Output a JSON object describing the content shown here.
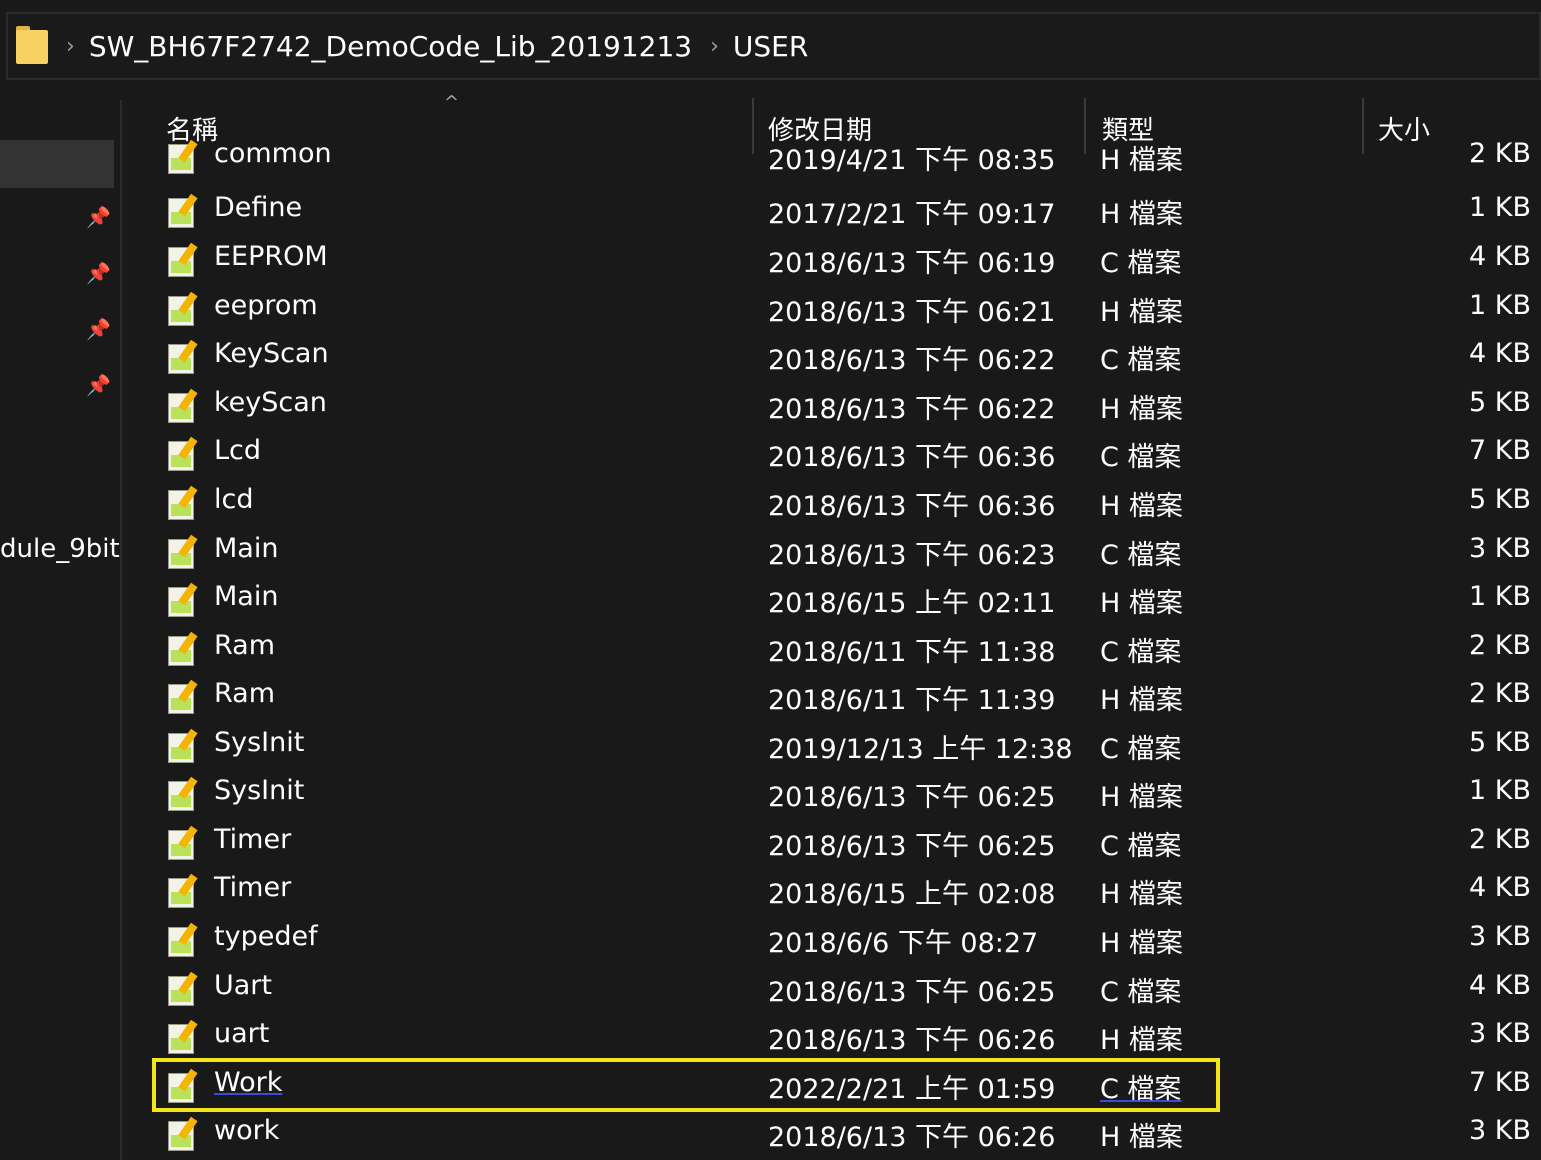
{
  "address_bar": {
    "crumbs": [
      "SW_BH67F2742_DemoCode_Lib_20191213",
      "USER"
    ],
    "separator": "›"
  },
  "nav_pane": {
    "partial_item": "dule_9bit"
  },
  "columns": {
    "name": "名稱",
    "date": "修改日期",
    "type": "類型",
    "size": "大小"
  },
  "files": [
    {
      "name": "common",
      "date": "2019/4/21 下午 08:35",
      "type": "H 檔案",
      "size": "2 KB"
    },
    {
      "name": "Define",
      "date": "2017/2/21 下午 09:17",
      "type": "H 檔案",
      "size": "1 KB"
    },
    {
      "name": "EEPROM",
      "date": "2018/6/13 下午 06:19",
      "type": "C 檔案",
      "size": "4 KB"
    },
    {
      "name": "eeprom",
      "date": "2018/6/13 下午 06:21",
      "type": "H 檔案",
      "size": "1 KB"
    },
    {
      "name": "KeyScan",
      "date": "2018/6/13 下午 06:22",
      "type": "C 檔案",
      "size": "4 KB"
    },
    {
      "name": "keyScan",
      "date": "2018/6/13 下午 06:22",
      "type": "H 檔案",
      "size": "5 KB"
    },
    {
      "name": "Lcd",
      "date": "2018/6/13 下午 06:36",
      "type": "C 檔案",
      "size": "7 KB"
    },
    {
      "name": "lcd",
      "date": "2018/6/13 下午 06:36",
      "type": "H 檔案",
      "size": "5 KB"
    },
    {
      "name": "Main",
      "date": "2018/6/13 下午 06:23",
      "type": "C 檔案",
      "size": "3 KB"
    },
    {
      "name": "Main",
      "date": "2018/6/15 上午 02:11",
      "type": "H 檔案",
      "size": "1 KB"
    },
    {
      "name": "Ram",
      "date": "2018/6/11 下午 11:38",
      "type": "C 檔案",
      "size": "2 KB"
    },
    {
      "name": "Ram",
      "date": "2018/6/11 下午 11:39",
      "type": "H 檔案",
      "size": "2 KB"
    },
    {
      "name": "SysInit",
      "date": "2019/12/13 上午 12:38",
      "type": "C 檔案",
      "size": "5 KB"
    },
    {
      "name": "SysInit",
      "date": "2018/6/13 下午 06:25",
      "type": "H 檔案",
      "size": "1 KB"
    },
    {
      "name": "Timer",
      "date": "2018/6/13 下午 06:25",
      "type": "C 檔案",
      "size": "2 KB"
    },
    {
      "name": "Timer",
      "date": "2018/6/15 上午 02:08",
      "type": "H 檔案",
      "size": "4 KB"
    },
    {
      "name": "typedef",
      "date": "2018/6/6 下午 08:27",
      "type": "H 檔案",
      "size": "3 KB"
    },
    {
      "name": "Uart",
      "date": "2018/6/13 下午 06:25",
      "type": "C 檔案",
      "size": "4 KB"
    },
    {
      "name": "uart",
      "date": "2018/6/13 下午 06:26",
      "type": "H 檔案",
      "size": "3 KB"
    },
    {
      "name": "Work",
      "date": "2022/2/21 上午 01:59",
      "type": "C 檔案",
      "size": "7 KB"
    },
    {
      "name": "work",
      "date": "2018/6/13 下午 06:26",
      "type": "H 檔案",
      "size": "3 KB"
    }
  ],
  "colors": {
    "background": "#191919",
    "highlight_box": "#f2e51c",
    "text": "#ffffff"
  }
}
